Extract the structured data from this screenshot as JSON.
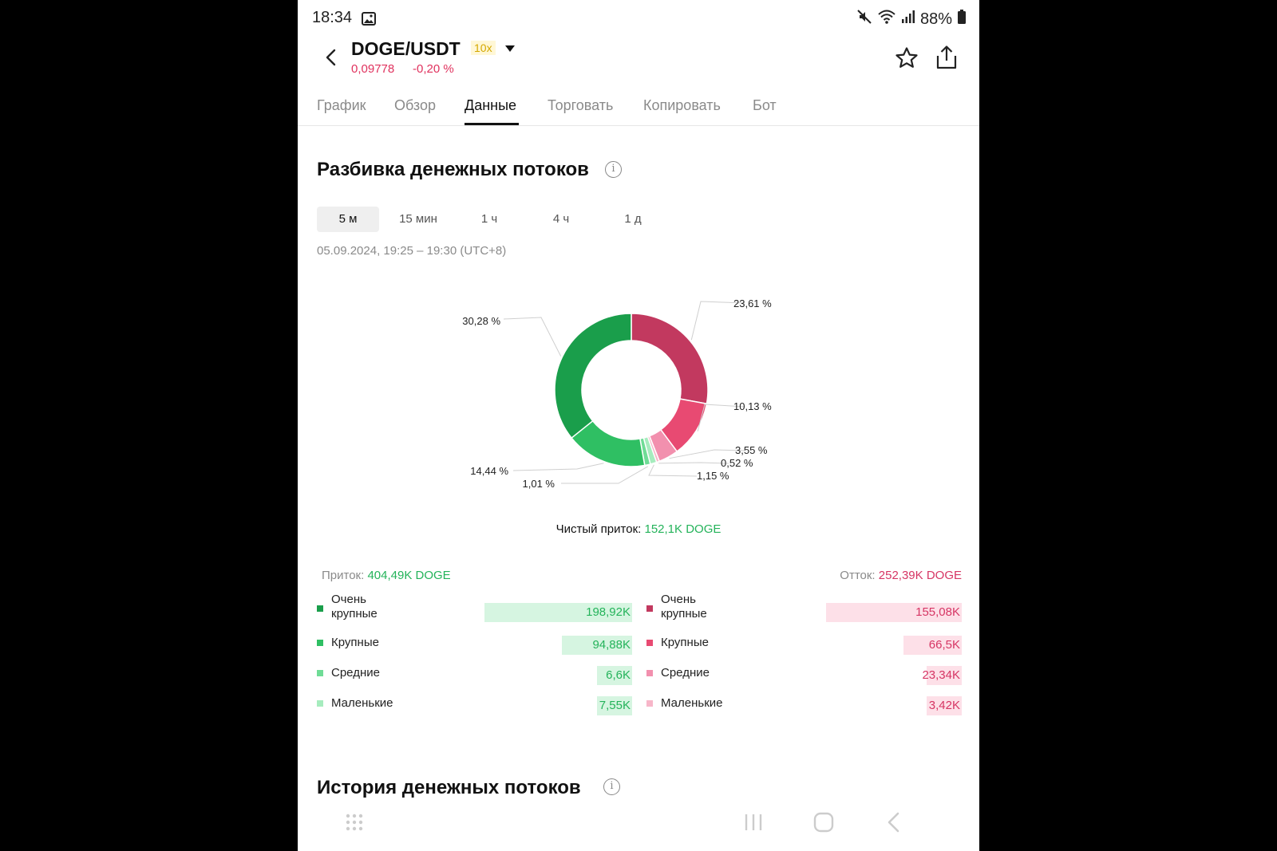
{
  "status": {
    "time": "18:34",
    "battery": "88%"
  },
  "header": {
    "pair": "DOGE/USDT",
    "leverage": "10x",
    "price": "0,09778",
    "change": "-0,20 %"
  },
  "tabs": [
    "График",
    "Обзор",
    "Данные",
    "Торговать",
    "Копировать",
    "Бот"
  ],
  "active_tab": "Данные",
  "breakdown": {
    "title": "Разбивка денежных потоков",
    "periods": [
      "5 м",
      "15 мин",
      "1 ч",
      "4 ч",
      "1 д"
    ],
    "active_period": "5 м",
    "date_range": "05.09.2024, 19:25 – 19:30 (UTC+8)",
    "net_label": "Чистый приток:",
    "net_value": "152,1K DOGE",
    "inflow_label": "Приток:",
    "inflow_value": "404,49K DOGE",
    "outflow_label": "Отток:",
    "outflow_value": "252,39K DOGE",
    "inflow_rows": [
      {
        "label": "Очень крупные",
        "value": "198,92K",
        "amount": 198.92,
        "color": "#1a9e4b"
      },
      {
        "label": "Крупные",
        "value": "94,88K",
        "amount": 94.88,
        "color": "#2fbf63"
      },
      {
        "label": "Средние",
        "value": "6,6K",
        "amount": 6.6,
        "color": "#6fdc96"
      },
      {
        "label": "Маленькие",
        "value": "7,55K",
        "amount": 7.55,
        "color": "#a6ecbe"
      }
    ],
    "outflow_rows": [
      {
        "label": "Очень крупные",
        "value": "155,08K",
        "amount": 155.08,
        "color": "#c2395f"
      },
      {
        "label": "Крупные",
        "value": "66,5K",
        "amount": 66.5,
        "color": "#e84a72"
      },
      {
        "label": "Средние",
        "value": "23,34K",
        "amount": 23.34,
        "color": "#f290ae"
      },
      {
        "label": "Маленькие",
        "value": "3,42K",
        "amount": 3.42,
        "color": "#f7b6c9"
      }
    ]
  },
  "chart_data": {
    "type": "pie",
    "slices": [
      {
        "label": "Очень крупные (отток)",
        "value": 23.61,
        "text": "23,61 %",
        "color": "#c2395f"
      },
      {
        "label": "Крупные (отток)",
        "value": 10.13,
        "text": "10,13 %",
        "color": "#e84a72"
      },
      {
        "label": "Средние (отток)",
        "value": 3.55,
        "text": "3,55 %",
        "color": "#f290ae"
      },
      {
        "label": "Маленькие (отток)",
        "value": 0.52,
        "text": "0,52 %",
        "color": "#f7b6c9"
      },
      {
        "label": "Маленькие (приток)",
        "value": 1.15,
        "text": "1,15 %",
        "color": "#a6ecbe"
      },
      {
        "label": "Средние (приток)",
        "value": 1.01,
        "text": "1,01 %",
        "color": "#6fdc96"
      },
      {
        "label": "Крупные (приток)",
        "value": 14.44,
        "text": "14,44 %",
        "color": "#2fbf63"
      },
      {
        "label": "Очень крупные (приток)",
        "value": 30.28,
        "text": "30,28 %",
        "color": "#1a9e4b"
      }
    ]
  },
  "history": {
    "title": "История денежных потоков"
  }
}
